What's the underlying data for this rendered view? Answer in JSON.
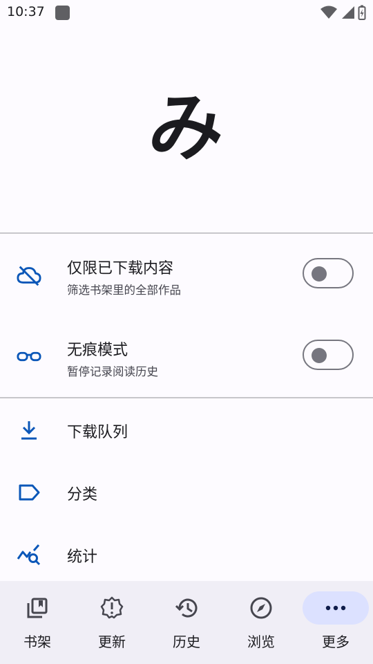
{
  "status_bar": {
    "time": "10:37"
  },
  "logo": {
    "glyph": "み"
  },
  "toggles": [
    {
      "title": "仅限已下载内容",
      "subtitle": "筛选书架里的全部作品",
      "icon": "cloud-off-icon",
      "on": false
    },
    {
      "title": "无痕模式",
      "subtitle": "暂停记录阅读历史",
      "icon": "glasses-icon",
      "on": false
    }
  ],
  "menu": [
    {
      "label": "下载队列",
      "icon": "download-icon"
    },
    {
      "label": "分类",
      "icon": "label-icon"
    },
    {
      "label": "统计",
      "icon": "stats-icon"
    }
  ],
  "bottom_nav": [
    {
      "label": "书架",
      "icon": "library-icon",
      "active": false
    },
    {
      "label": "更新",
      "icon": "updates-icon",
      "active": false
    },
    {
      "label": "历史",
      "icon": "history-icon",
      "active": false
    },
    {
      "label": "浏览",
      "icon": "compass-icon",
      "active": false
    },
    {
      "label": "更多",
      "icon": "more-icon",
      "active": true
    }
  ],
  "colors": {
    "accent": "#0b57b8",
    "nav_active_pill": "#dce1ff",
    "background": "#fdfbff"
  }
}
